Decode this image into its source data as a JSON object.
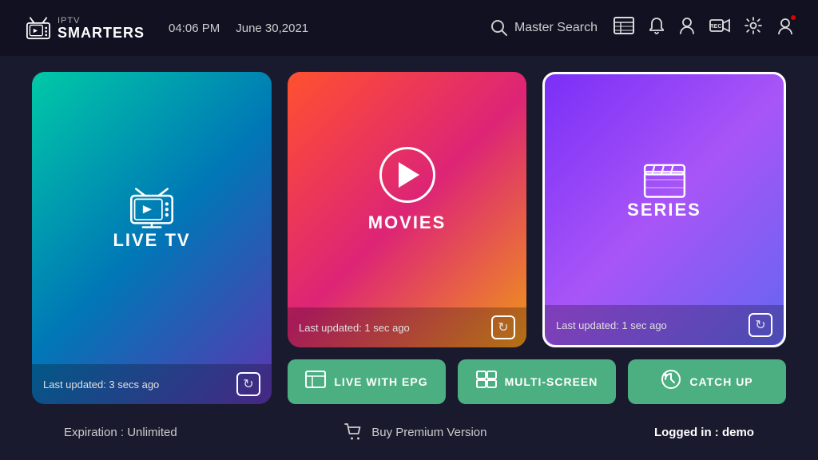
{
  "header": {
    "logo_iptv": "IPTV",
    "logo_smarters": "SMARTERS",
    "time": "04:06 PM",
    "date": "June 30,2021",
    "search_label": "Master Search"
  },
  "cards": {
    "live_tv": {
      "label": "LIVE TV",
      "footer_text": "Last updated: 3 secs ago"
    },
    "movies": {
      "label": "MOVIES",
      "footer_text": "Last updated: 1 sec ago"
    },
    "series": {
      "label": "SERIES",
      "footer_text": "Last updated: 1 sec ago"
    }
  },
  "buttons": {
    "live_epg": "LIVE WITH EPG",
    "multi_screen": "MULTI-SCREEN",
    "catch_up": "CATCH UP"
  },
  "footer": {
    "expiration_label": "Expiration : Unlimited",
    "premium_label": "Buy Premium Version",
    "logged_in_label": "Logged in :",
    "logged_in_user": "demo"
  }
}
